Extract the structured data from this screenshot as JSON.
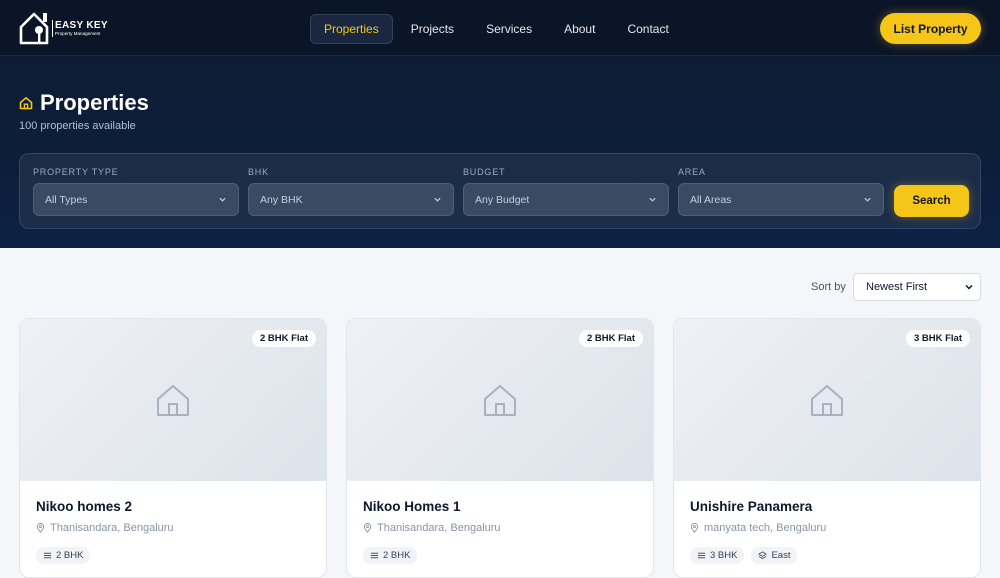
{
  "nav": {
    "logo_title": "EASY KEY",
    "logo_sub": "Property Management",
    "items": [
      {
        "label": "Properties",
        "active": true
      },
      {
        "label": "Projects",
        "active": false
      },
      {
        "label": "Services",
        "active": false
      },
      {
        "label": "About",
        "active": false
      },
      {
        "label": "Contact",
        "active": false
      }
    ],
    "cta": "List Property"
  },
  "hero": {
    "title": "Properties",
    "subtitle": "100 properties available"
  },
  "filters": [
    {
      "label": "PROPERTY TYPE",
      "value": "All Types"
    },
    {
      "label": "BHK",
      "value": "Any BHK"
    },
    {
      "label": "BUDGET",
      "value": "Any Budget"
    },
    {
      "label": "AREA",
      "value": "All Areas"
    }
  ],
  "search_label": "Search",
  "sort": {
    "label": "Sort by",
    "value": "Newest First"
  },
  "cards": [
    {
      "badge": "2 BHK Flat",
      "name": "Nikoo homes 2",
      "location": "Thanisandara, Bengaluru",
      "chips": [
        {
          "icon": "bed-icon",
          "label": "2 BHK"
        }
      ]
    },
    {
      "badge": "2 BHK Flat",
      "name": "Nikoo Homes 1",
      "location": "Thanisandara, Bengaluru",
      "chips": [
        {
          "icon": "bed-icon",
          "label": "2 BHK"
        }
      ]
    },
    {
      "badge": "3 BHK Flat",
      "name": "Unishire Panamera",
      "location": "manyata tech, Bengaluru",
      "chips": [
        {
          "icon": "bed-icon",
          "label": "3 BHK"
        },
        {
          "icon": "compass-icon",
          "label": "East"
        }
      ]
    }
  ],
  "colors": {
    "accent": "#f5c518",
    "nav_bg": "#0b1528",
    "hero_bg": "#0e1c33"
  }
}
